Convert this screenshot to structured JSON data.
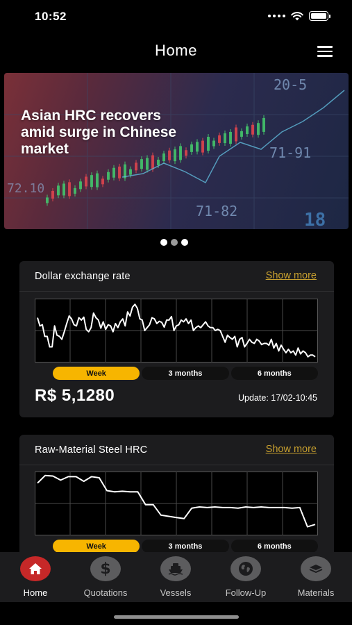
{
  "status_bar": {
    "time": "10:52"
  },
  "header": {
    "title": "Home",
    "menu_icon": "hamburger-icon"
  },
  "banner": {
    "title": "Asian HRC recovers amid surge in Chinese market",
    "bg_labels": [
      "20-5",
      "71-91",
      "72.10",
      "71-82",
      "18"
    ],
    "slides": 3,
    "active_slide": 2
  },
  "cards": [
    {
      "title": "Dollar exchange rate",
      "show_more": "Show more",
      "periods": [
        "Week",
        "3 months",
        "6 months"
      ],
      "active_period": "Week",
      "price": "R$ 5,1280",
      "update": "Update: 17/02-10:45"
    },
    {
      "title": "Raw-Material Steel HRC",
      "show_more": "Show more",
      "periods": [
        "Week",
        "3 months",
        "6 months"
      ],
      "active_period": "Week"
    }
  ],
  "chart_data": [
    {
      "type": "line",
      "ylim": [
        0,
        100
      ],
      "values": [
        72,
        58,
        60,
        40,
        40,
        22,
        22,
        58,
        42,
        40,
        35,
        48,
        62,
        75,
        70,
        60,
        58,
        72,
        68,
        73,
        52,
        48,
        55,
        80,
        72,
        68,
        54,
        65,
        52,
        60,
        58,
        48,
        62,
        55,
        65,
        70,
        58,
        82,
        75,
        90,
        95,
        88,
        70,
        68,
        50,
        55,
        60,
        72,
        70,
        62,
        66,
        64,
        56,
        68,
        68,
        74,
        50,
        58,
        60,
        68,
        65,
        70,
        62,
        68,
        50,
        55,
        58,
        55,
        60,
        65,
        58,
        55,
        55,
        50,
        52,
        50,
        40,
        30,
        42,
        38,
        35,
        40,
        22,
        35,
        38,
        22,
        28,
        35,
        30,
        28,
        35,
        32,
        26,
        28,
        28,
        25,
        35,
        20,
        28,
        15,
        25,
        18,
        12,
        18,
        12,
        15,
        8,
        20,
        10,
        15,
        12,
        5,
        8,
        8,
        5
      ],
      "grid": true
    },
    {
      "type": "line",
      "ylim": [
        0,
        100
      ],
      "values": [
        85,
        98,
        97,
        90,
        96,
        96,
        88,
        96,
        94,
        72,
        70,
        71,
        70,
        70,
        48,
        48,
        30,
        28,
        26,
        24,
        42,
        44,
        43,
        44,
        43,
        43,
        42,
        44,
        43,
        44,
        43,
        43,
        43,
        42,
        43,
        10,
        14
      ],
      "grid": true
    }
  ],
  "tab_bar": {
    "items": [
      {
        "label": "Home",
        "icon": "house-icon",
        "active": true
      },
      {
        "label": "Quotations",
        "icon": "dollar-icon",
        "active": false
      },
      {
        "label": "Vessels",
        "icon": "ship-icon",
        "active": false
      },
      {
        "label": "Follow-Up",
        "icon": "globe-icon",
        "active": false
      },
      {
        "label": "Materials",
        "icon": "layers-icon",
        "active": false
      }
    ]
  },
  "colors": {
    "accent": "#f7b500",
    "link": "#c8a02f",
    "active_tab": "#c62828",
    "card_bg": "#1c1c1e"
  }
}
